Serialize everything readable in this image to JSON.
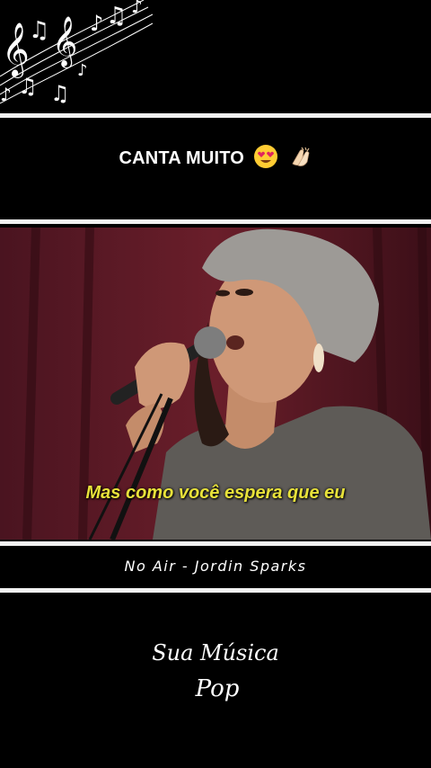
{
  "caption": {
    "text": "CANTA MUITO",
    "emojis": [
      "heart-eyes-emoji",
      "clapping-hands-emoji"
    ]
  },
  "video": {
    "subtitle": "Mas como você espera que eu"
  },
  "song": {
    "title": "No Air - Jordin Sparks"
  },
  "brand": {
    "line1": "Sua Música",
    "line2": "Pop"
  },
  "colors": {
    "background": "#000000",
    "divider": "#f2f2f2",
    "subtitle": "#e8e23a",
    "caption": "#ffffff"
  },
  "icons": [
    "music-notes-icon"
  ]
}
